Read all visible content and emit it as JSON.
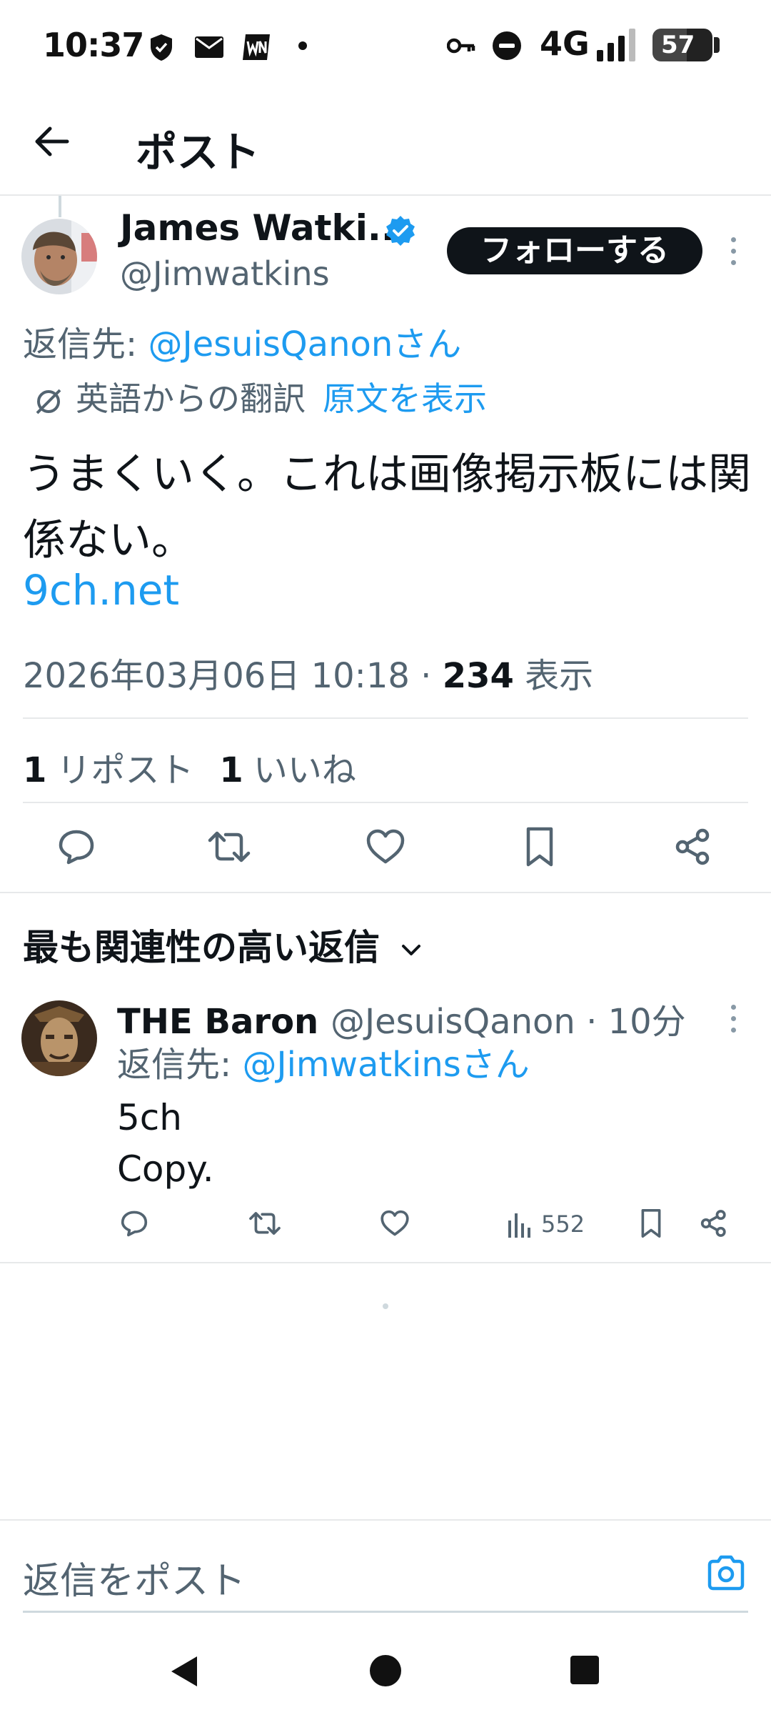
{
  "status_bar": {
    "time": "10:37",
    "network": "4G",
    "battery": "57",
    "battery_level_percent": 57,
    "icons": [
      "shield-icon",
      "mail-icon",
      "app-icon",
      "dot-icon",
      "vpn-key-icon",
      "dnd-icon",
      "signal-icon",
      "battery-icon"
    ]
  },
  "app_bar": {
    "title": "ポスト",
    "back_icon": "arrow-left-icon"
  },
  "post": {
    "author_name": "James Watki...",
    "verified": true,
    "handle": "@Jimwatkins",
    "follow_label": "フォローする",
    "reply_prefix": "返信先: ",
    "reply_mention": "@JesuisQanonさん",
    "translation_note": "英語からの翻訳",
    "show_original": "原文を表示",
    "text": "うまくいく。これは画像掲示板には関係ない。",
    "link": "9ch.net",
    "timestamp": "2026年03月06日 10:18 · ",
    "view_count": "234",
    "view_suffix": " 表示",
    "repost_count": "1",
    "repost_label": "リポスト",
    "like_count": "1",
    "like_label": "いいね"
  },
  "replies_section": {
    "title": "最も関連性の高い返信"
  },
  "reply": {
    "author_name": "THE Baron",
    "handle_time": "@JesuisQanon · 10分",
    "reply_prefix": "返信先: ",
    "reply_mention": "@Jimwatkinsさん",
    "line1": "5ch",
    "line2": "Copy.",
    "views": "552"
  },
  "composer": {
    "placeholder": "返信をポスト",
    "camera_icon": "camera-icon"
  },
  "colors": {
    "accent": "#1d9bf0",
    "text": "#0f1419",
    "secondary": "#536471",
    "divider": "#e7e9ea"
  }
}
